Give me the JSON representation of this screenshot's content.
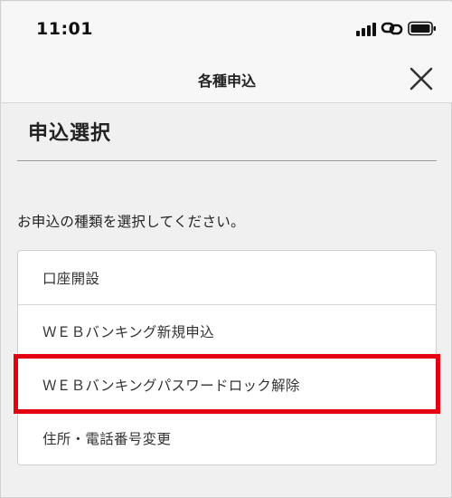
{
  "status_bar": {
    "time": "11:01"
  },
  "header": {
    "title": "各種申込"
  },
  "section": {
    "title": "申込選択"
  },
  "instruction": "お申込の種類を選択してください。",
  "options": [
    {
      "label": "口座開設"
    },
    {
      "label": "ＷＥＢバンキング新規申込"
    },
    {
      "label": "ＷＥＢバンキングパスワードロック解除"
    },
    {
      "label": "住所・電話番号変更"
    }
  ],
  "highlight": {
    "color": "#e3000f",
    "option_index": 2
  },
  "icons": {
    "signal": "signal-icon",
    "link": "link-icon",
    "battery": "battery-icon",
    "close": "close-icon"
  }
}
